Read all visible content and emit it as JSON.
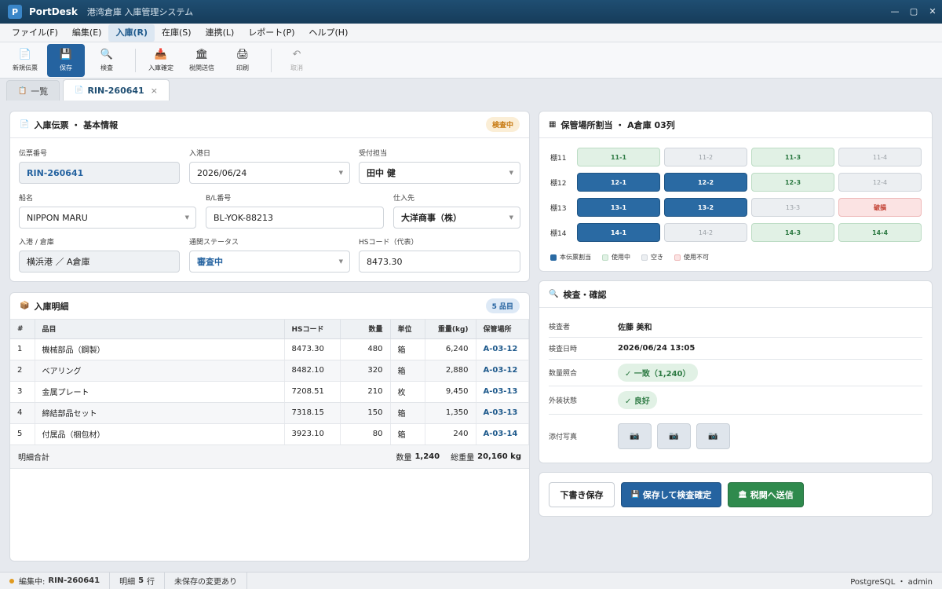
{
  "window": {
    "logo": "P",
    "app_name": "PortDesk",
    "subtitle": "港湾倉庫 入庫管理システム",
    "min": "—",
    "max": "▢",
    "close": "✕"
  },
  "menu": [
    "ファイル(F)",
    "編集(E)",
    "入庫(R)",
    "在庫(S)",
    "連携(L)",
    "レポート(P)",
    "ヘルプ(H)"
  ],
  "toolbar": {
    "new": "新規伝票",
    "save": "保存",
    "inspect": "検査",
    "confirm": "入庫確定",
    "customs": "税関送信",
    "print": "印刷",
    "cancel": "取消"
  },
  "tabs": {
    "list": "一覧",
    "current": "RIN-260641",
    "close": "×"
  },
  "form": {
    "title": "入庫伝票 ・ 基本情報",
    "status_badge": "検査中",
    "voucher_label": "伝票番号",
    "voucher_value": "RIN-260641",
    "arrival_label": "入港日",
    "arrival_value": "2026/06/24",
    "staff_label": "受付担当",
    "staff_value": "田中 健",
    "ship_label": "船名",
    "ship_value": "NIPPON MARU",
    "bl_label": "B/L番号",
    "bl_value": "BL-YOK-88213",
    "supplier_label": "仕入先",
    "supplier_value": "大洋商事（株）",
    "port_label": "入港 / 倉庫",
    "port_value": "横浜港 ／ A倉庫",
    "customs_label": "通関ステータス",
    "customs_value": "審査中",
    "hs_label": "HSコード（代表）",
    "hs_value": "8473.30"
  },
  "details": {
    "title": "入庫明細",
    "count_badge": "5 品目",
    "headers": [
      "#",
      "品目",
      "HSコード",
      "数量",
      "単位",
      "重量(kg)",
      "保管場所"
    ],
    "rows": [
      [
        "1",
        "機械部品（鋼製）",
        "8473.30",
        "480",
        "箱",
        "6,240",
        "A-03-12"
      ],
      [
        "2",
        "ベアリング",
        "8482.10",
        "320",
        "箱",
        "2,880",
        "A-03-12"
      ],
      [
        "3",
        "金属プレート",
        "7208.51",
        "210",
        "枚",
        "9,450",
        "A-03-13"
      ],
      [
        "4",
        "締結部品セット",
        "7318.15",
        "150",
        "箱",
        "1,350",
        "A-03-13"
      ],
      [
        "5",
        "付属品（梱包材）",
        "3923.10",
        "80",
        "箱",
        "240",
        "A-03-14"
      ]
    ],
    "total_label": "明細合計",
    "qty_label": "数量",
    "qty_total": "1,240",
    "weight_label": "総重量",
    "weight_total": "20,160 kg"
  },
  "storage": {
    "title": "保管場所割当 ・ A倉庫 03列",
    "rows": [
      {
        "label": "棚11",
        "cells": [
          {
            "id": "11-1",
            "state": "used"
          },
          {
            "id": "11-2",
            "state": "empty"
          },
          {
            "id": "11-3",
            "state": "used"
          },
          {
            "id": "11-4",
            "state": "empty"
          }
        ]
      },
      {
        "label": "棚12",
        "cells": [
          {
            "id": "12-1",
            "state": "mine"
          },
          {
            "id": "12-2",
            "state": "mine"
          },
          {
            "id": "12-3",
            "state": "used"
          },
          {
            "id": "12-4",
            "state": "empty"
          }
        ]
      },
      {
        "label": "棚13",
        "cells": [
          {
            "id": "13-1",
            "state": "mine"
          },
          {
            "id": "13-2",
            "state": "mine"
          },
          {
            "id": "13-3",
            "state": "empty"
          },
          {
            "id": "破損",
            "state": "bad"
          }
        ]
      },
      {
        "label": "棚14",
        "cells": [
          {
            "id": "14-1",
            "state": "mine"
          },
          {
            "id": "14-2",
            "state": "empty"
          },
          {
            "id": "14-3",
            "state": "used"
          },
          {
            "id": "14-4",
            "state": "used"
          }
        ]
      }
    ],
    "legend": [
      "本伝票割当",
      "使用中",
      "空き",
      "使用不可"
    ],
    "colors": {
      "mine": "#2a6aa3",
      "used": "#e1f1e5",
      "empty": "#eceff2",
      "bad": "#fbe3e3"
    }
  },
  "inspection": {
    "title": "検査・確認",
    "inspector_label": "検査者",
    "inspector_value": "佐藤 美和",
    "date_label": "検査日時",
    "date_value": "2026/06/24 13:05",
    "qty_label": "数量照合",
    "qty_value": "✓ 一致（1,240）",
    "exterior_label": "外装状態",
    "exterior_value": "✓ 良好",
    "photo_label": "添付写真"
  },
  "actions": {
    "draft": "下書き保存",
    "save_confirm": "保存して検査確定",
    "send_customs": "税関へ送信"
  },
  "status": {
    "editing_label": "編集中:",
    "editing_value": "RIN-260641",
    "lines_label": "明細",
    "lines_value": "5",
    "lines_unit": "行",
    "unsaved": "未保存の変更あり",
    "db": "PostgreSQL ・ admin"
  }
}
